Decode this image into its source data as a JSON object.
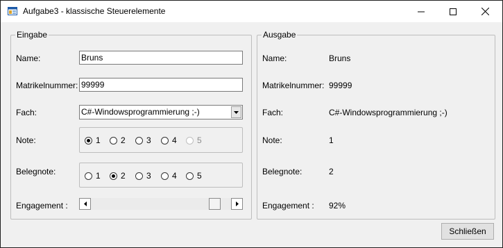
{
  "window": {
    "title": "Aufgabe3 - klassische Steuerelemente"
  },
  "eingabe": {
    "title": "Eingabe",
    "name_label": "Name:",
    "name_value": "Bruns",
    "matrikel_label": "Matrikelnummer:",
    "matrikel_value": "99999",
    "fach_label": "Fach:",
    "fach_value": "C#-Windowsprogrammierung ;-)",
    "note_label": "Note:",
    "note_options": [
      "1",
      "2",
      "3",
      "4",
      "5"
    ],
    "note_selected": "1",
    "note_disabled": "5",
    "belegnote_label": "Belegnote:",
    "belegnote_options": [
      "1",
      "2",
      "3",
      "4",
      "5"
    ],
    "belegnote_selected": "2",
    "engagement_label": "Engagement :",
    "engagement_fraction": 0.92
  },
  "ausgabe": {
    "title": "Ausgabe",
    "name_label": "Name:",
    "name_value": "Bruns",
    "matrikel_label": "Matrikelnummer:",
    "matrikel_value": "99999",
    "fach_label": "Fach:",
    "fach_value": "C#-Windowsprogrammierung ;-)",
    "note_label": "Note:",
    "note_value": "1",
    "belegnote_label": "Belegnote:",
    "belegnote_value": "2",
    "engagement_label": "Engagement :",
    "engagement_value": "92%"
  },
  "buttons": {
    "close_label": "Schließen"
  },
  "icons": {
    "app": "app-window-icon",
    "minimize": "minimize-icon",
    "maximize": "maximize-icon",
    "close": "close-icon",
    "dropdown": "dropdown-arrow-icon",
    "scroll_left": "scroll-left-arrow-icon",
    "scroll_right": "scroll-right-arrow-icon"
  }
}
